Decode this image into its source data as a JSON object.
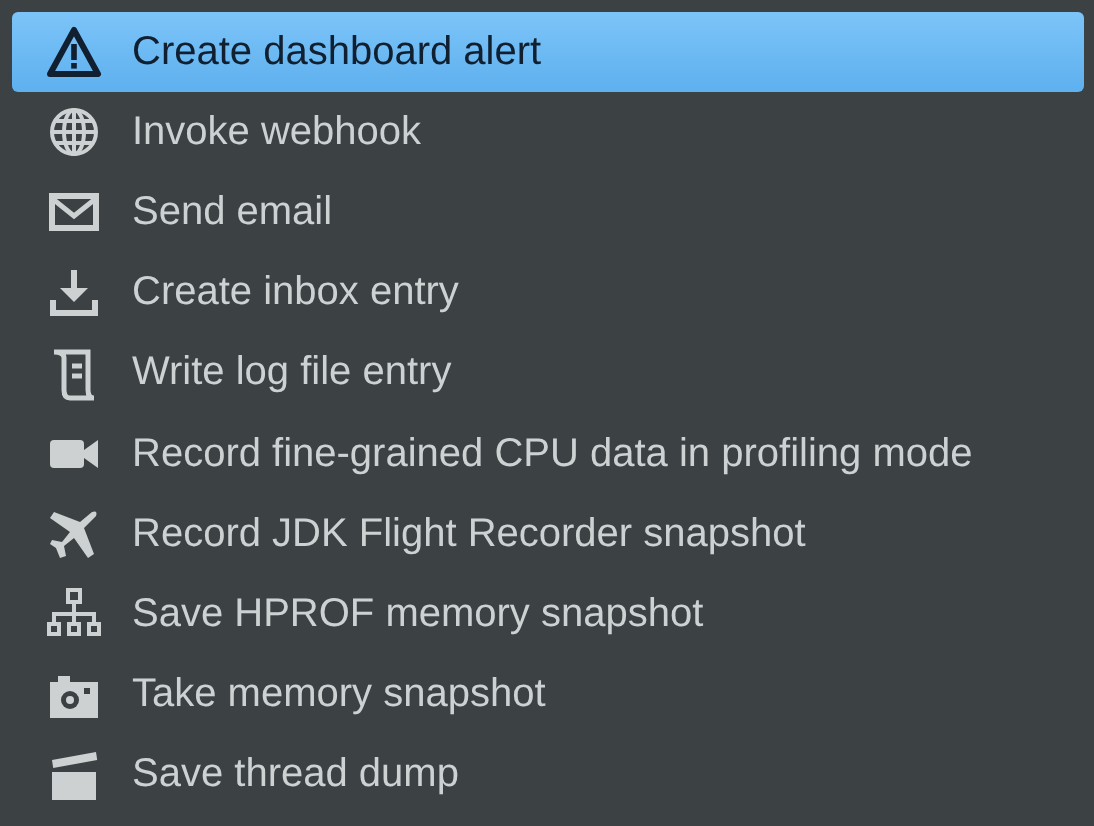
{
  "menu": {
    "items": [
      {
        "label": "Create dashboard alert",
        "kind": "alert",
        "selected": true
      },
      {
        "label": "Invoke webhook",
        "kind": "globe",
        "selected": false
      },
      {
        "label": "Send email",
        "kind": "mail",
        "selected": false
      },
      {
        "label": "Create inbox entry",
        "kind": "download",
        "selected": false
      },
      {
        "label": "Write log file entry",
        "kind": "scroll",
        "selected": false
      },
      {
        "label": "Record fine-grained CPU data in profiling mode",
        "kind": "camera",
        "selected": false
      },
      {
        "label": "Record JDK Flight Recorder snapshot",
        "kind": "plane",
        "selected": false
      },
      {
        "label": "Save HPROF memory snapshot",
        "kind": "tree",
        "selected": false
      },
      {
        "label": "Take memory snapshot",
        "kind": "photo",
        "selected": false
      },
      {
        "label": "Save thread dump",
        "kind": "clapper",
        "selected": false
      }
    ]
  }
}
